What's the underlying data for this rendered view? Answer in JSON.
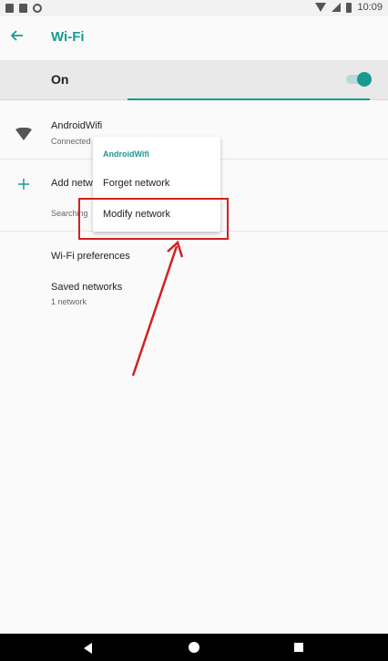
{
  "status_bar": {
    "time": "10:09"
  },
  "app_bar": {
    "title": "Wi-Fi",
    "back_icon": "arrow-left-icon"
  },
  "master_switch": {
    "label": "On",
    "state": "on"
  },
  "networks": {
    "connected": {
      "ssid": "AndroidWifi",
      "status": "Connected"
    },
    "add_network": {
      "label": "Add network",
      "status": "Searching"
    }
  },
  "preferences": {
    "wifi_preferences": "Wi-Fi preferences",
    "saved_networks": {
      "label": "Saved networks",
      "count": "1 network"
    }
  },
  "context_menu": {
    "title": "AndroidWifi",
    "items": [
      "Forget network",
      "Modify network"
    ]
  },
  "colors": {
    "accent": "#1a9a8f",
    "annotation": "#d32020",
    "nav_bar": "#000000"
  }
}
